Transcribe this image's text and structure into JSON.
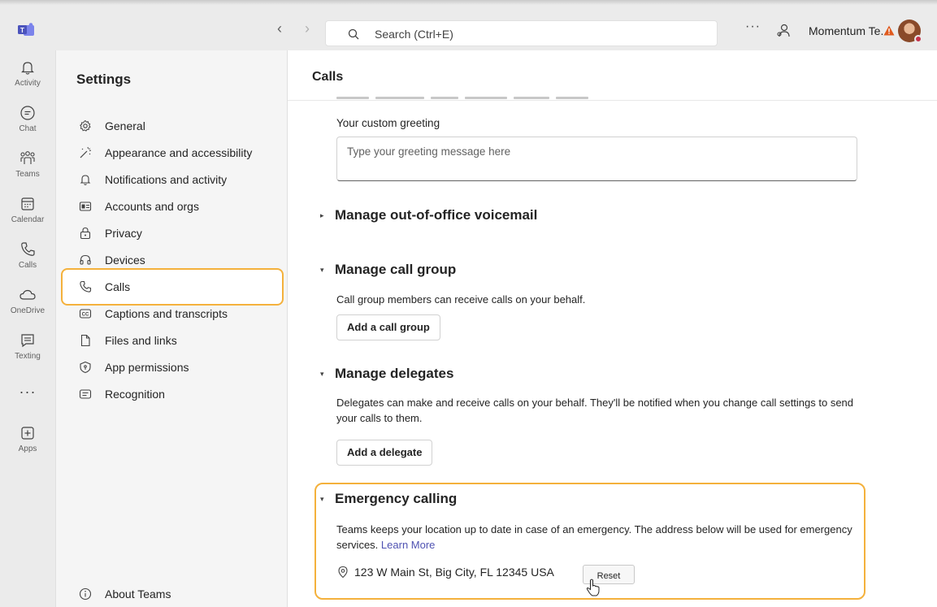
{
  "titlebar": {
    "search_placeholder": "Search (Ctrl+E)",
    "more": "···",
    "org_name": "Momentum Te...",
    "back": "‹",
    "forward": "›"
  },
  "rail": {
    "items": [
      {
        "label": "Activity",
        "icon": "bell-icon"
      },
      {
        "label": "Chat",
        "icon": "chat-icon"
      },
      {
        "label": "Teams",
        "icon": "teams-icon"
      },
      {
        "label": "Calendar",
        "icon": "calendar-icon"
      },
      {
        "label": "Calls",
        "icon": "phone-icon"
      },
      {
        "label": "OneDrive",
        "icon": "cloud-icon"
      },
      {
        "label": "Texting",
        "icon": "message-icon"
      },
      {
        "label": "Apps",
        "icon": "apps-plus-icon"
      }
    ],
    "more": "···"
  },
  "settings": {
    "title": "Settings",
    "items": [
      {
        "label": "General",
        "icon": "gear-icon"
      },
      {
        "label": "Appearance and accessibility",
        "icon": "wand-icon"
      },
      {
        "label": "Notifications and activity",
        "icon": "bell-icon"
      },
      {
        "label": "Accounts and orgs",
        "icon": "id-card-icon"
      },
      {
        "label": "Privacy",
        "icon": "lock-icon"
      },
      {
        "label": "Devices",
        "icon": "headset-icon"
      },
      {
        "label": "Calls",
        "icon": "phone-icon",
        "selected": true
      },
      {
        "label": "Captions and transcripts",
        "icon": "cc-icon"
      },
      {
        "label": "Files and links",
        "icon": "file-icon"
      },
      {
        "label": "App permissions",
        "icon": "shield-icon"
      },
      {
        "label": "Recognition",
        "icon": "recognition-icon"
      }
    ],
    "about": "About Teams"
  },
  "content": {
    "title": "Calls",
    "greeting_label": "Your custom greeting",
    "greeting_placeholder": "Type your greeting message here",
    "sections": {
      "voicemail": {
        "title": "Manage out-of-office voicemail",
        "caret": "▸"
      },
      "call_group": {
        "title": "Manage call group",
        "caret": "▾",
        "description": "Call group members can receive calls on your behalf.",
        "button": "Add a call group"
      },
      "delegates": {
        "title": "Manage delegates",
        "caret": "▾",
        "description": "Delegates can make and receive calls on your behalf. They'll be notified when you change call settings to send your calls to them.",
        "button": "Add a delegate"
      },
      "emergency": {
        "title": "Emergency calling",
        "caret": "▾",
        "description": "Teams keeps your location up to date in case of an emergency. The address below will be used for emergency services.",
        "link": "Learn More",
        "address": "123 W Main St, Big City, FL 12345 USA",
        "reset": "Reset"
      }
    }
  },
  "colors": {
    "highlight": "#f4b13c",
    "link": "#4f52b2",
    "brand": "#5b5fc7"
  }
}
